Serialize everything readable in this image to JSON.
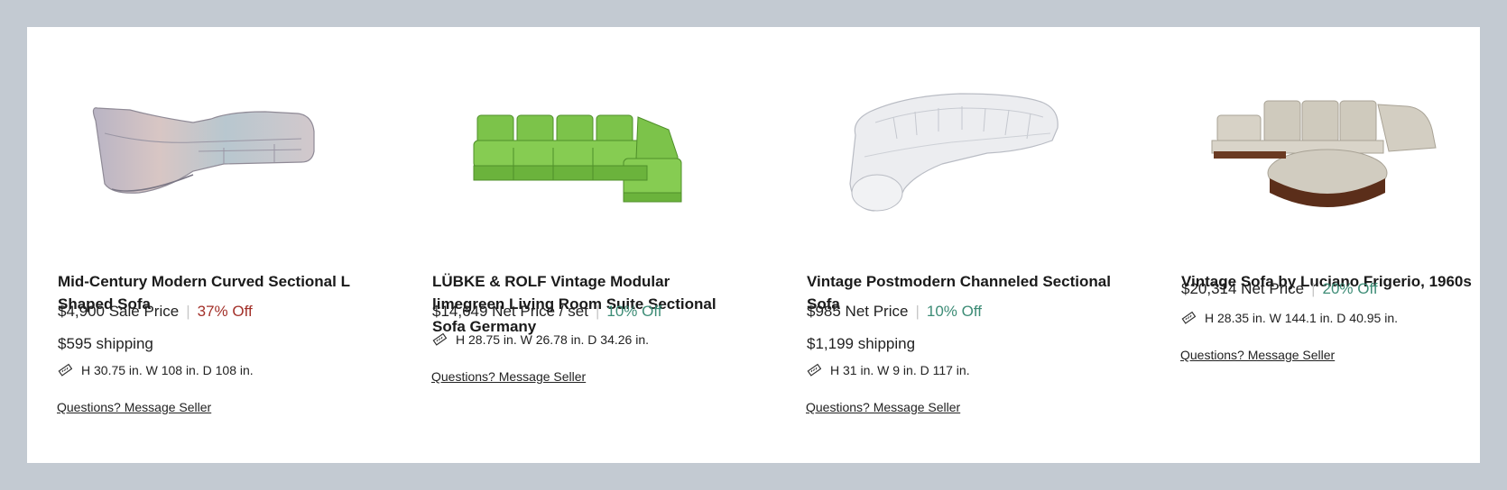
{
  "products": [
    {
      "title": "Mid-Century Modern Curved Sectional L Shaped Sofa",
      "price": "$4,900 Sale Price",
      "discount": "37% Off",
      "discount_color": "#a3312a",
      "shipping": "$595 shipping",
      "dimensions": "H 30.75 in. W 108 in. D 108 in.",
      "message_link": "Questions? Message Seller",
      "icon": "ruler-icon"
    },
    {
      "title": "LÜBKE & ROLF Vintage Modular limegreen Living Room Suite Sectional Sofa Germany",
      "price": "$14,649 Net Price / set",
      "discount": "10% Off",
      "discount_color": "#3d8c76",
      "dimensions": "H 28.75 in. W 26.78 in. D 34.26 in.",
      "message_link": "Questions? Message Seller",
      "icon": "ruler-icon"
    },
    {
      "title": "Vintage Postmodern Channeled Sectional Sofa",
      "price": "$985 Net Price",
      "discount": "10% Off",
      "discount_color": "#3d8c76",
      "shipping": "$1,199 shipping",
      "dimensions": "H 31 in. W 9 in. D 117 in.",
      "message_link": "Questions? Message Seller",
      "icon": "ruler-icon"
    },
    {
      "title": "Vintage Sofa by Luciano Frigerio, 1960s",
      "price": "$20,314 Net Price",
      "discount": "20% Off",
      "discount_color": "#3d8c76",
      "dimensions": "H 28.35 in. W 144.1 in. D 40.95 in.",
      "message_link": "Questions? Message Seller",
      "icon": "ruler-icon"
    }
  ]
}
